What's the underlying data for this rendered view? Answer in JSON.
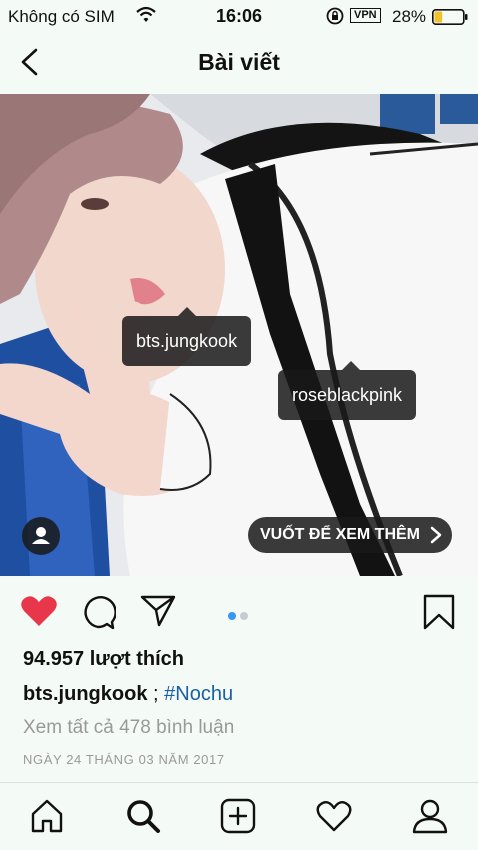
{
  "status_bar": {
    "carrier": "Không có SIM",
    "time": "16:06",
    "vpn": "VPN",
    "battery_percent": "28%",
    "battery_level": 0.28
  },
  "header": {
    "title": "Bài viết"
  },
  "photo": {
    "tags": [
      "bts.jungkook",
      "roseblackpink"
    ],
    "swipe_label": "VUỐT ĐỂ XEM THÊM",
    "carousel_pages": 2,
    "carousel_current": 1
  },
  "post": {
    "likes": "94.957 lượt thích",
    "caption_user": "bts.jungkook",
    "caption_text": " ; ",
    "caption_hashtag": "#Nochu",
    "comments_link": "Xem tất cả 478 bình luận",
    "date": "NGÀY 24 THÁNG 03 NĂM 2017"
  },
  "colors": {
    "like": "#e8364a",
    "hashtag": "#1b5fa6",
    "dot_active": "#3897f0"
  },
  "icons": {
    "status": [
      "wifi-icon",
      "orientation-lock-icon",
      "battery-icon"
    ],
    "actions": [
      "heart-icon",
      "comment-icon",
      "share-icon",
      "bookmark-icon"
    ],
    "nav": [
      "home-icon",
      "search-icon",
      "add-icon",
      "activity-icon",
      "profile-icon"
    ]
  }
}
